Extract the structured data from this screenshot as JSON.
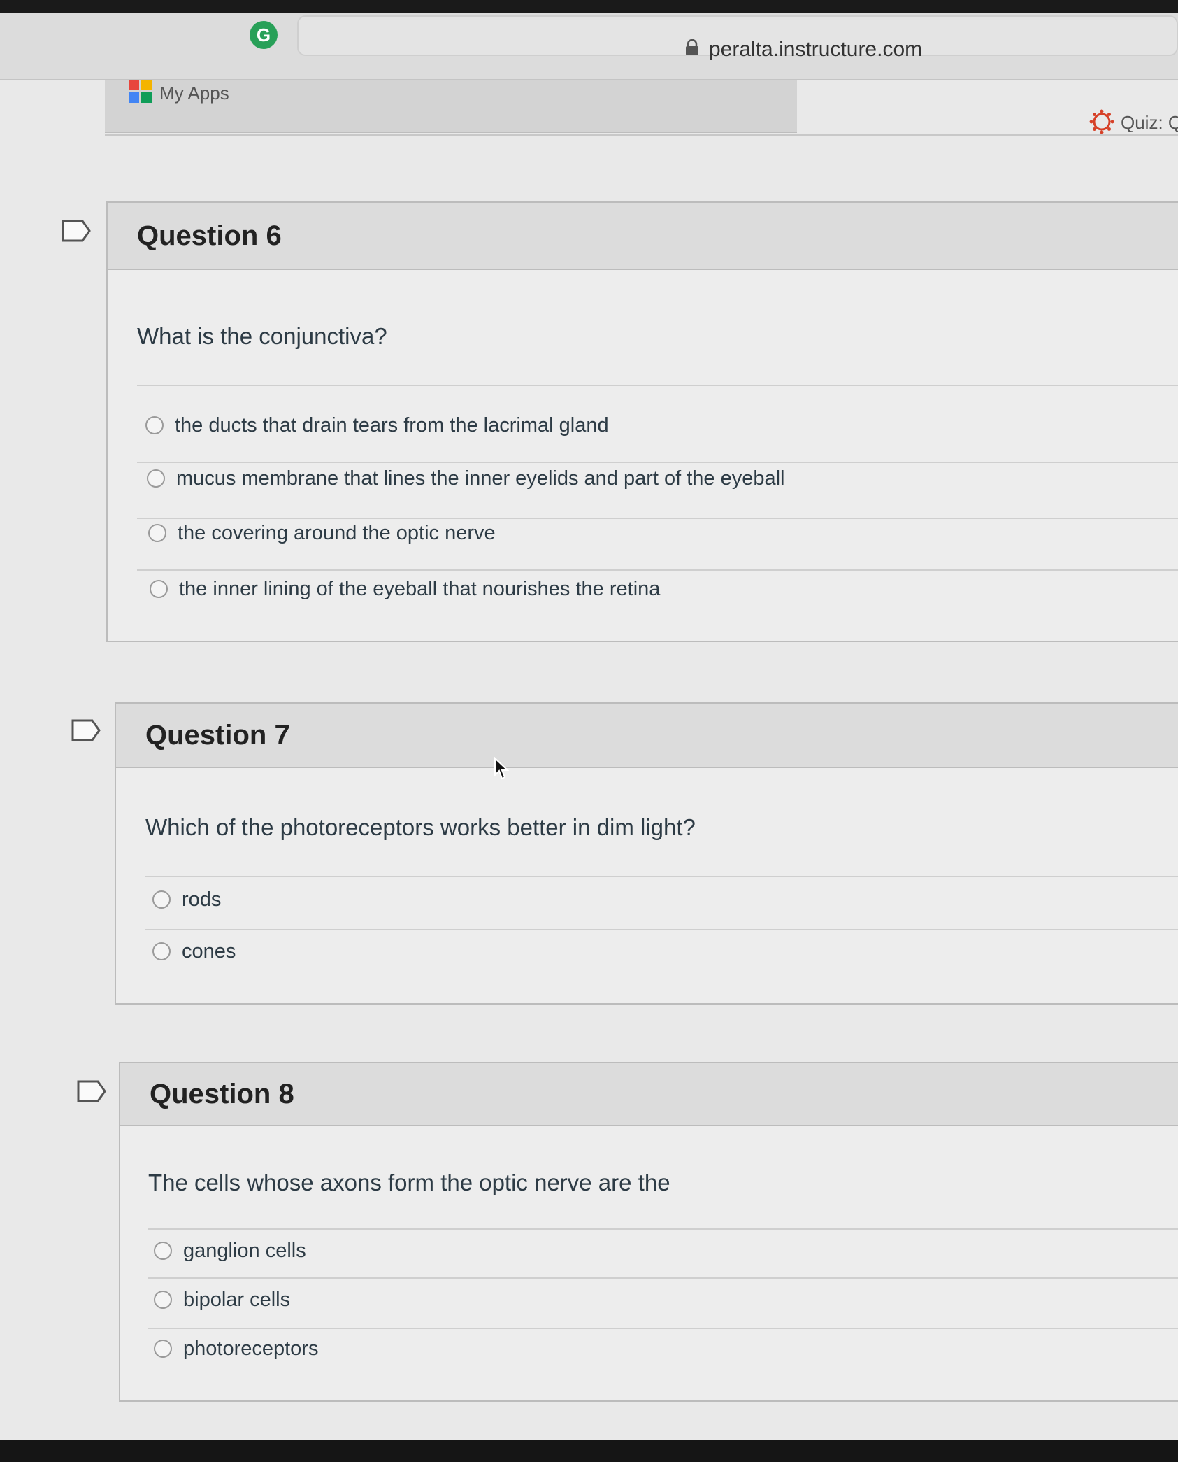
{
  "browser": {
    "url": "peralta.instructure.com",
    "extension_icon_letter": "G",
    "bookmarks": [
      {
        "label": "My Apps"
      }
    ],
    "tab_title": "Quiz: Q"
  },
  "questions": [
    {
      "title": "Question 6",
      "text": "What is the conjunctiva?",
      "answers": [
        "the ducts that drain tears from the lacrimal gland",
        "mucus membrane that lines the inner eyelids and part of the eyeball",
        "the covering around the optic nerve",
        "the inner lining of the eyeball that nourishes the retina"
      ]
    },
    {
      "title": "Question 7",
      "text": "Which of the photoreceptors works better in dim light?",
      "answers": [
        "rods",
        "cones"
      ]
    },
    {
      "title": "Question 8",
      "text": "The cells whose axons form the optic nerve are the",
      "answers": [
        "ganglion cells",
        "bipolar cells",
        "photoreceptors"
      ]
    }
  ],
  "colors": {
    "extension_green": "#28a058",
    "canvas_red": "#d64027"
  }
}
